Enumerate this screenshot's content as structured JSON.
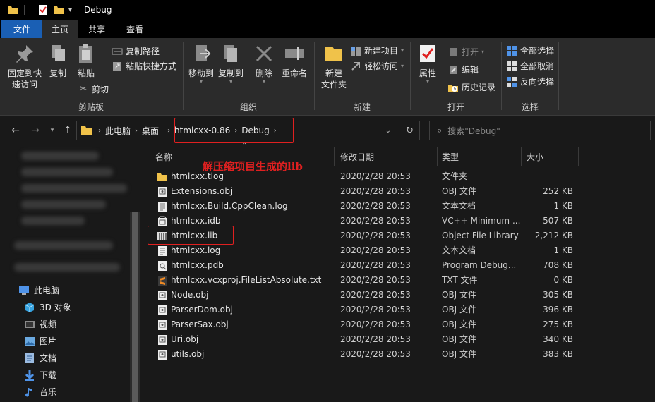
{
  "window": {
    "title": "Debug"
  },
  "tabs": [
    {
      "label": "文件"
    },
    {
      "label": "主页"
    },
    {
      "label": "共享"
    },
    {
      "label": "查看"
    }
  ],
  "ribbon": {
    "clipboard": {
      "label": "剪贴板",
      "pin": "固定到快\n速访问",
      "copy": "复制",
      "paste": "粘贴",
      "copy_path": "复制路径",
      "paste_shortcut": "粘贴快捷方式",
      "cut": "剪切"
    },
    "organize": {
      "label": "组织",
      "move_to": "移动到",
      "copy_to": "复制到",
      "delete": "删除",
      "rename": "重命名"
    },
    "new": {
      "label": "新建",
      "new_folder": "新建\n文件夹",
      "new_item": "新建项目",
      "easy_access": "轻松访问"
    },
    "open": {
      "label": "打开",
      "properties": "属性",
      "open": "打开",
      "edit": "编辑",
      "history": "历史记录"
    },
    "select": {
      "label": "选择",
      "select_all": "全部选择",
      "select_none": "全部取消",
      "invert": "反向选择"
    }
  },
  "address": {
    "crumbs": [
      "此电脑",
      "桌面",
      "htmlcxx-0.86",
      "Debug"
    ],
    "search_placeholder": "搜索\"Debug\""
  },
  "navpane": {
    "items": [
      {
        "label": "此电脑",
        "icon": "computer-icon"
      },
      {
        "label": "3D 对象",
        "icon": "3d-objects-icon"
      },
      {
        "label": "视频",
        "icon": "video-icon"
      },
      {
        "label": "图片",
        "icon": "pictures-icon"
      },
      {
        "label": "文档",
        "icon": "documents-icon"
      },
      {
        "label": "下载",
        "icon": "download-icon"
      },
      {
        "label": "音乐",
        "icon": "music-icon"
      }
    ]
  },
  "columns": {
    "name": "名称",
    "date": "修改日期",
    "type": "类型",
    "size": "大小"
  },
  "files": [
    {
      "name": "htmlcxx.tlog",
      "date": "2020/2/28 20:53",
      "type": "文件夹",
      "size": "",
      "icon": "folder-icon"
    },
    {
      "name": "Extensions.obj",
      "date": "2020/2/28 20:53",
      "type": "OBJ 文件",
      "size": "252 KB",
      "icon": "obj-file-icon"
    },
    {
      "name": "htmlcxx.Build.CppClean.log",
      "date": "2020/2/28 20:53",
      "type": "文本文档",
      "size": "1 KB",
      "icon": "text-file-icon"
    },
    {
      "name": "htmlcxx.idb",
      "date": "2020/2/28 20:53",
      "type": "VC++ Minimum ...",
      "size": "507 KB",
      "icon": "idb-file-icon"
    },
    {
      "name": "htmlcxx.lib",
      "date": "2020/2/28 20:53",
      "type": "Object File Library",
      "size": "2,212 KB",
      "icon": "lib-file-icon"
    },
    {
      "name": "htmlcxx.log",
      "date": "2020/2/28 20:53",
      "type": "文本文档",
      "size": "1 KB",
      "icon": "text-file-icon"
    },
    {
      "name": "htmlcxx.pdb",
      "date": "2020/2/28 20:53",
      "type": "Program Debug...",
      "size": "708 KB",
      "icon": "pdb-file-icon"
    },
    {
      "name": "htmlcxx.vcxproj.FileListAbsolute.txt",
      "date": "2020/2/28 20:53",
      "type": "TXT 文件",
      "size": "0 KB",
      "icon": "sublime-text-icon"
    },
    {
      "name": "Node.obj",
      "date": "2020/2/28 20:53",
      "type": "OBJ 文件",
      "size": "305 KB",
      "icon": "obj-file-icon"
    },
    {
      "name": "ParserDom.obj",
      "date": "2020/2/28 20:53",
      "type": "OBJ 文件",
      "size": "396 KB",
      "icon": "obj-file-icon"
    },
    {
      "name": "ParserSax.obj",
      "date": "2020/2/28 20:53",
      "type": "OBJ 文件",
      "size": "275 KB",
      "icon": "obj-file-icon"
    },
    {
      "name": "Uri.obj",
      "date": "2020/2/28 20:53",
      "type": "OBJ 文件",
      "size": "340 KB",
      "icon": "obj-file-icon"
    },
    {
      "name": "utils.obj",
      "date": "2020/2/28 20:53",
      "type": "OBJ 文件",
      "size": "383 KB",
      "icon": "obj-file-icon"
    }
  ],
  "annotation": {
    "text": "解压缩项目生成的lib"
  },
  "colors": {
    "accent": "#1a5fb4",
    "annotation": "#e02020",
    "background": "#191919",
    "ribbon": "#2b2b2b"
  }
}
